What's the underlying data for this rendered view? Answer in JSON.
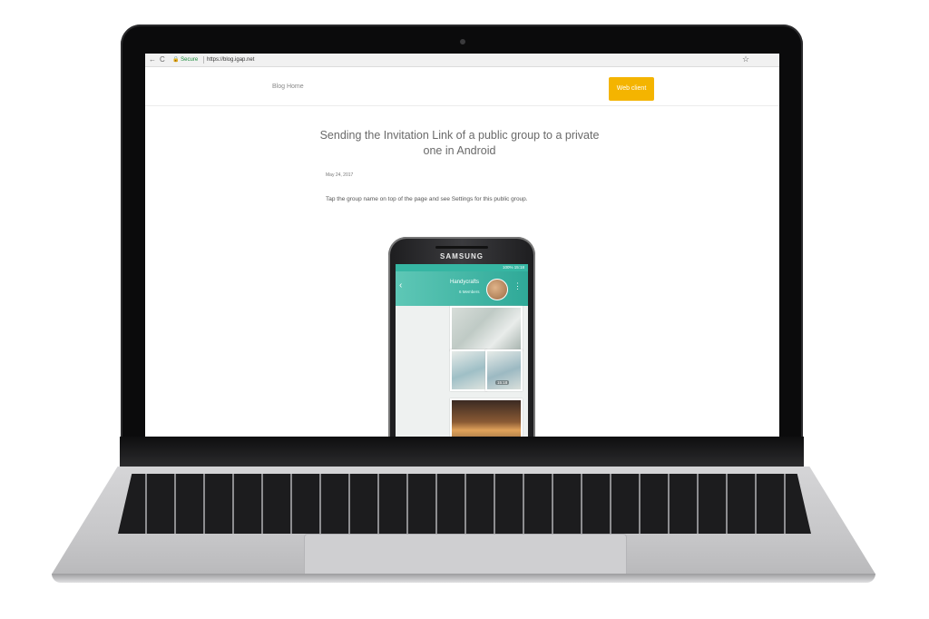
{
  "browser": {
    "back_icon": "←",
    "reload_icon": "C",
    "secure_label": "Secure",
    "url": "https://blog.igap.net",
    "bookmark_icon": "☆"
  },
  "site": {
    "nav_blog_home": "Blog Home",
    "web_client_button": "Web client",
    "accent_color": "#f4b400"
  },
  "article": {
    "title": "Sending the Invitation Link of a public group to a private one in Android",
    "date": "May 24, 2017",
    "body": "Tap the group name on top of the page and see Settings for this public group."
  },
  "phone": {
    "brand": "SAMSUNG",
    "status": "100% 15:18",
    "group_name": "Handycrafts",
    "members": "6 Members",
    "message_time": "15:18",
    "back_icon": "‹",
    "menu_icon": "⋮",
    "header_color": "#36b6a3"
  }
}
